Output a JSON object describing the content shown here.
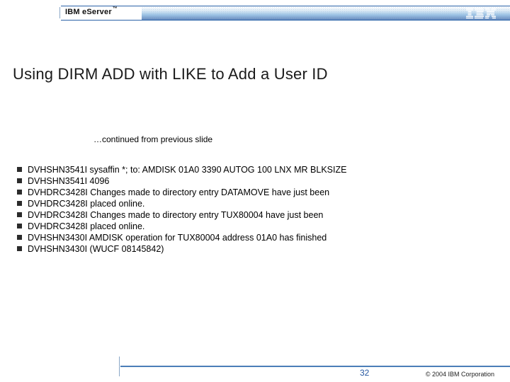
{
  "header": {
    "brand_pre": "IBM e",
    "brand_post": "Server",
    "tm": "™"
  },
  "title": "Using DIRM ADD with LIKE to Add a User ID",
  "continued": "…continued from previous slide",
  "bullets": [
    "DVHSHN3541I sysaffin *; to: AMDISK 01A0 3390 AUTOG 100 LNX MR BLKSIZE",
    "DVHSHN3541I 4096",
    "DVHDRC3428I Changes made to directory entry DATAMOVE have just been",
    "DVHDRC3428I placed online.",
    "DVHDRC3428I Changes made to directory entry TUX80004 have just been",
    "DVHDRC3428I placed online.",
    "DVHSHN3430I AMDISK operation for TUX80004 address 01A0 has finished",
    "DVHSHN3430I (WUCF 08145842)"
  ],
  "footer": {
    "page": "32",
    "copyright": "© 2004 IBM Corporation"
  }
}
